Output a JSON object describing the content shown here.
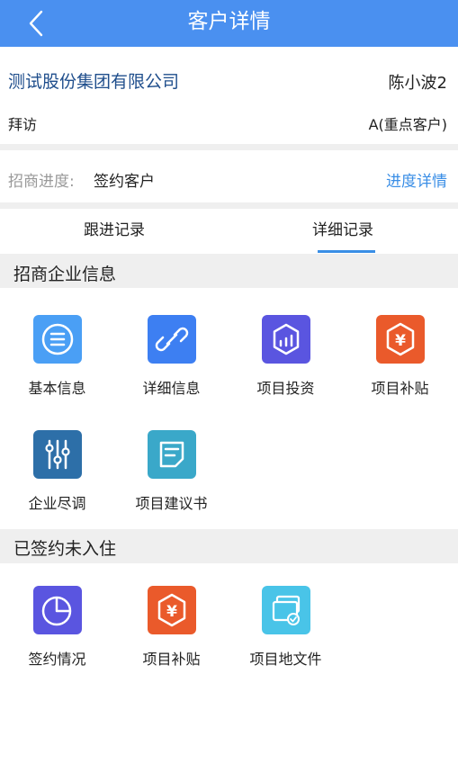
{
  "header": {
    "title": "客户详情"
  },
  "company": {
    "name": "测试股份集团有限公司",
    "contact": "陈小波2",
    "visit_type": "拜访",
    "level": "A(重点客户)"
  },
  "progress": {
    "label": "招商进度:",
    "value": "签约客户",
    "link": "进度详情"
  },
  "tabs": [
    {
      "label": "跟进记录",
      "active": false
    },
    {
      "label": "详细记录",
      "active": true
    }
  ],
  "sections": [
    {
      "title": "招商企业信息",
      "items": [
        {
          "label": "基本信息",
          "icon": "list-icon",
          "color": "#4a9ff5"
        },
        {
          "label": "详细信息",
          "icon": "link-icon",
          "color": "#3d7ff2"
        },
        {
          "label": "项目投资",
          "icon": "chart-icon",
          "color": "#5a55e0"
        },
        {
          "label": "项目补贴",
          "icon": "yuan-icon",
          "color": "#ea5a2b"
        },
        {
          "label": "企业尽调",
          "icon": "sliders-icon",
          "color": "#2d6fa8"
        },
        {
          "label": "项目建议书",
          "icon": "document-icon",
          "color": "#3aa8c9"
        }
      ]
    },
    {
      "title": "已签约未入住",
      "items": [
        {
          "label": "签约情况",
          "icon": "pie-icon",
          "color": "#5a55e0"
        },
        {
          "label": "项目补贴",
          "icon": "yuan-icon",
          "color": "#ea5a2b"
        },
        {
          "label": "项目地文件",
          "icon": "files-icon",
          "color": "#49c4e8"
        }
      ]
    }
  ]
}
